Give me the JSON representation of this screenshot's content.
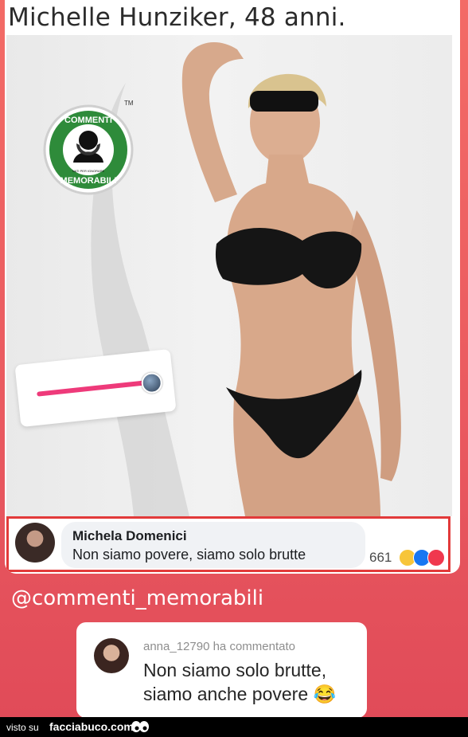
{
  "post": {
    "title": "Michelle Hunziker, 48 anni.",
    "logo": {
      "top_text": "COMMENTI",
      "bottom_text": "MEMORABILI",
      "small_text": "NATI PER IGNORARE",
      "mark": "TM",
      "color": "#2e8b3a"
    },
    "story_slider": {
      "accent_color": "#ee3a7a",
      "value": 0.97
    },
    "comment": {
      "author": "Michela Domenici",
      "text": "Non siamo povere, siamo solo brutte",
      "reaction_count": "661",
      "reactions": [
        "haha-icon",
        "like-icon",
        "love-icon"
      ]
    }
  },
  "handle": "@commenti_memorabili",
  "reply": {
    "meta": "anna_12790 ha commentato",
    "text": "Non siamo solo brutte, siamo anche povere 😂"
  },
  "footer": {
    "prefix": "visto su",
    "brand": "facciabuco.com"
  },
  "colors": {
    "background": "#ea5a60",
    "highlight_border": "#e23a3a",
    "like": "#1877f2",
    "love": "#f0384e"
  }
}
